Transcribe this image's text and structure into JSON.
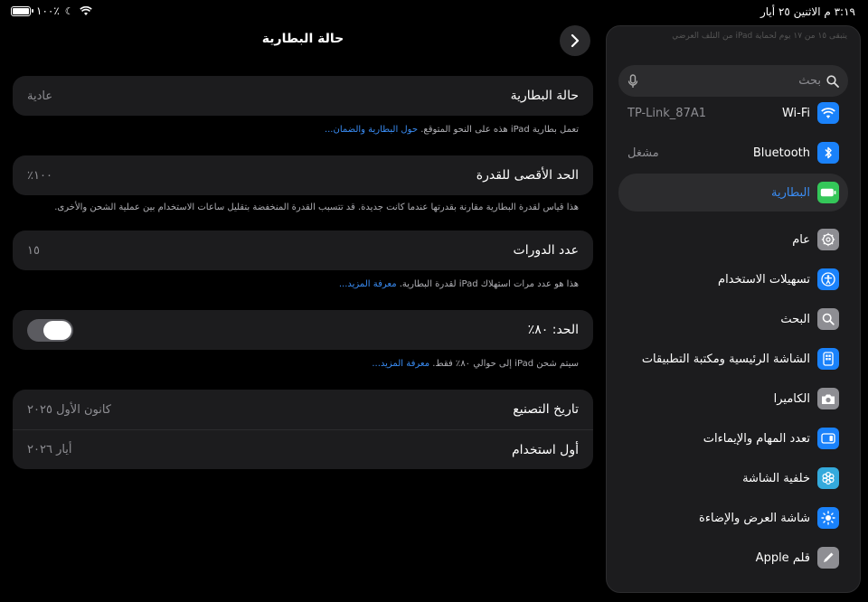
{
  "status": {
    "time": "٣:١٩ م  الاثنين ٢٥ أيار",
    "battery": "١٠٠٪"
  },
  "detail": {
    "title": "حالة البطارية",
    "battery_health": {
      "label": "حالة البطارية",
      "value": "عادية"
    },
    "battery_footer": {
      "text": "تعمل بطارية iPad هذه على النحو المتوقع. ",
      "link": "حول البطارية والضمان..."
    },
    "max_capacity": {
      "label": "الحد الأقصى للقدرة",
      "value": "١٠٠٪"
    },
    "capacity_footer": {
      "text": "هذا قياس لقدرة البطارية مقارنة بقدرتها عندما كانت جديدة. قد تتسبب القدرة المنخفضة بتقليل ساعات الاستخدام بين عملية الشحن والأخرى."
    },
    "cycle_count": {
      "label": "عدد الدورات",
      "value": "١٥"
    },
    "cycle_footer": {
      "text": "هذا هو عدد مرات استهلاك iPad لقدرة البطارية. ",
      "link": "معرفة المزيد..."
    },
    "limit": {
      "label": "الحد: ٨٠٪",
      "enabled": true
    },
    "limit_footer": {
      "text": "سيتم شحن iPad إلى حوالي ٨٠٪ فقط. ",
      "link": "معرفة المزيد..."
    },
    "manufacture": {
      "label": "تاريخ التصنيع",
      "value": "كانون الأول ٢٠٢٥"
    },
    "first_use": {
      "label": "أول استخدام",
      "value": "أيار ٢٠٢٦"
    }
  },
  "sidebar": {
    "faded_text": "يتبقى ١٥ من ١٧ يوم لحماية iPad من التلف العرضي",
    "search_placeholder": "بحث",
    "items": [
      {
        "label": "Wi-Fi",
        "value": "TP-Link_87A1",
        "icon": "wifi-icon",
        "color": "#1a82fb"
      },
      {
        "label": "Bluetooth",
        "value": "مشغل",
        "icon": "bluetooth-icon",
        "color": "#1a82fb"
      },
      {
        "label": "البطارية",
        "value": "",
        "icon": "battery-icon",
        "color": "#34c759"
      },
      {
        "label": "عام",
        "value": "",
        "icon": "gear-icon",
        "color": "#8e8e93"
      },
      {
        "label": "تسهيلات الاستخدام",
        "value": "",
        "icon": "accessibility-icon",
        "color": "#1a82fb"
      },
      {
        "label": "البحث",
        "value": "",
        "icon": "search-icon",
        "color": "#8e8e93"
      },
      {
        "label": "الشاشة الرئيسية ومكتبة التطبيقات",
        "value": "",
        "icon": "home-screen-icon",
        "color": "#1a82fb"
      },
      {
        "label": "الكاميرا",
        "value": "",
        "icon": "camera-icon",
        "color": "#8e8e93"
      },
      {
        "label": "تعدد المهام والإيماءات",
        "value": "",
        "icon": "multitasking-icon",
        "color": "#1a82fb"
      },
      {
        "label": "خلفية الشاشة",
        "value": "",
        "icon": "wallpaper-icon",
        "color": "#34aadc"
      },
      {
        "label": "شاشة العرض والإضاءة",
        "value": "",
        "icon": "brightness-icon",
        "color": "#1a82fb"
      },
      {
        "label": "قلم Apple",
        "value": "",
        "icon": "pencil-icon",
        "color": "#8e8e93"
      }
    ]
  }
}
